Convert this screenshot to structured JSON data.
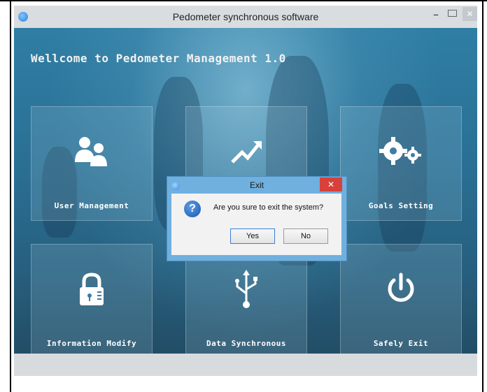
{
  "window": {
    "title": "Pedometer synchronous software",
    "minimize_glyph": "–",
    "close_glyph": "✕"
  },
  "main": {
    "welcome_text": "Wellcome to Pedometer Management 1.0",
    "tiles": [
      {
        "label": "User Management",
        "icon": "users-icon"
      },
      {
        "label": "",
        "icon": "chart-trend-icon"
      },
      {
        "label": "Goals Setting",
        "icon": "gears-icon"
      },
      {
        "label": "Information Modify",
        "icon": "lock-icon"
      },
      {
        "label": "Data Synchronous",
        "icon": "usb-icon"
      },
      {
        "label": "Safely Exit",
        "icon": "power-icon"
      }
    ]
  },
  "dialog": {
    "title": "Exit",
    "message": "Are you sure to exit the system?",
    "question_glyph": "?",
    "yes_label": "Yes",
    "no_label": "No",
    "close_glyph": "✕"
  },
  "colors": {
    "accent": "#2f7ea4",
    "dialog_frame": "#6fb0de",
    "close_red": "#d7413a"
  }
}
